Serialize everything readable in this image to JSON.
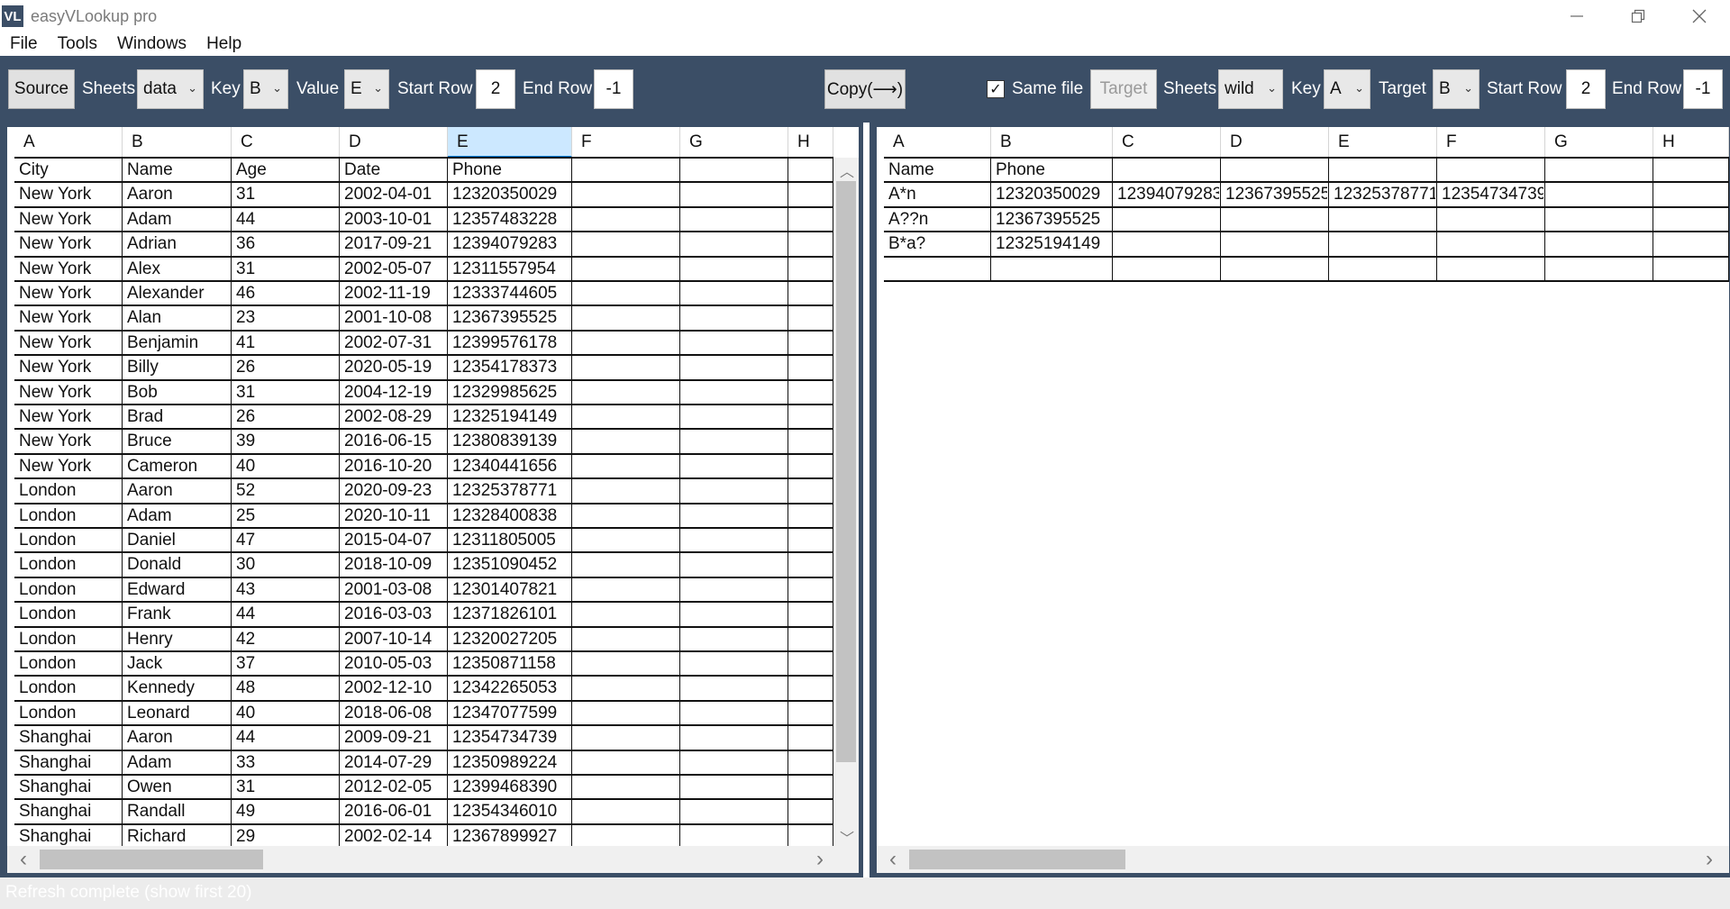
{
  "window": {
    "logo": "VL",
    "title": "easyVLookup pro",
    "controls": [
      "minimize-icon",
      "restore-icon",
      "close-icon"
    ]
  },
  "menu": [
    "File",
    "Tools",
    "Windows",
    "Help"
  ],
  "toolbar": {
    "source_label": "Source",
    "sheets_label": "Sheets",
    "source_sheet": "data",
    "key_label": "Key",
    "source_key": "B",
    "value_label": "Value",
    "source_value": "E",
    "start_row_label": "Start Row",
    "source_start_row": "2",
    "end_row_label": "End Row",
    "source_end_row": "-1",
    "copy_label": "Copy(⟶)",
    "same_file_label": "Same file",
    "same_file_checked": true,
    "target_button": "Target",
    "target_sheet": "wild",
    "target_key": "A",
    "target_label": "Target",
    "target_col": "B",
    "target_start_row": "2",
    "target_end_row": "-1"
  },
  "left_grid": {
    "columns": [
      "A",
      "B",
      "C",
      "D",
      "E",
      "F",
      "G",
      "H"
    ],
    "active_column": "E",
    "rows": [
      [
        "City",
        "Name",
        "Age",
        "Date",
        "Phone"
      ],
      [
        "New York",
        "Aaron",
        "31",
        "2002-04-01",
        "12320350029"
      ],
      [
        "New York",
        "Adam",
        "44",
        "2003-10-01",
        "12357483228"
      ],
      [
        "New York",
        "Adrian",
        "36",
        "2017-09-21",
        "12394079283"
      ],
      [
        "New York",
        "Alex",
        "31",
        "2002-05-07",
        "12311557954"
      ],
      [
        "New York",
        "Alexander",
        "46",
        "2002-11-19",
        "12333744605"
      ],
      [
        "New York",
        "Alan",
        "23",
        "2001-10-08",
        "12367395525"
      ],
      [
        "New York",
        "Benjamin",
        "41",
        "2002-07-31",
        "12399576178"
      ],
      [
        "New York",
        "Billy",
        "26",
        "2020-05-19",
        "12354178373"
      ],
      [
        "New York",
        "Bob",
        "31",
        "2004-12-19",
        "12329985625"
      ],
      [
        "New York",
        "Brad",
        "26",
        "2002-08-29",
        "12325194149"
      ],
      [
        "New York",
        "Bruce",
        "39",
        "2016-06-15",
        "12380839139"
      ],
      [
        "New York",
        "Cameron",
        "40",
        "2016-10-20",
        "12340441656"
      ],
      [
        "London",
        "Aaron",
        "52",
        "2020-09-23",
        "12325378771"
      ],
      [
        "London",
        "Adam",
        "25",
        "2020-10-11",
        "12328400838"
      ],
      [
        "London",
        "Daniel",
        "47",
        "2015-04-07",
        "12311805005"
      ],
      [
        "London",
        "Donald",
        "30",
        "2018-10-09",
        "12351090452"
      ],
      [
        "London",
        "Edward",
        "43",
        "2001-03-08",
        "12301407821"
      ],
      [
        "London",
        "Frank",
        "44",
        "2016-03-03",
        "12371826101"
      ],
      [
        "London",
        "Henry",
        "42",
        "2007-10-14",
        "12320027205"
      ],
      [
        "London",
        "Jack",
        "37",
        "2010-05-03",
        "12350871158"
      ],
      [
        "London",
        "Kennedy",
        "48",
        "2002-12-10",
        "12342265053"
      ],
      [
        "London",
        "Leonard",
        "40",
        "2018-06-08",
        "12347077599"
      ],
      [
        "Shanghai",
        "Aaron",
        "44",
        "2009-09-21",
        "12354734739"
      ],
      [
        "Shanghai",
        "Adam",
        "33",
        "2014-07-29",
        "12350989224"
      ],
      [
        "Shanghai",
        "Owen",
        "31",
        "2012-02-05",
        "12399468390"
      ],
      [
        "Shanghai",
        "Randall",
        "49",
        "2016-06-01",
        "12354346010"
      ],
      [
        "Shanghai",
        "Richard",
        "29",
        "2002-02-14",
        "12367899927"
      ]
    ]
  },
  "right_grid": {
    "columns": [
      "A",
      "B",
      "C",
      "D",
      "E",
      "F",
      "G",
      "H"
    ],
    "rows": [
      [
        "Name",
        "Phone",
        "",
        "",
        "",
        "",
        "",
        ""
      ],
      [
        "A*n",
        "12320350029",
        "12394079283",
        "12367395525",
        "12325378771",
        "12354734739",
        "",
        ""
      ],
      [
        "A??n",
        "12367395525",
        "",
        "",
        "",
        "",
        "",
        ""
      ],
      [
        "B*a?",
        "12325194149",
        "",
        "",
        "",
        "",
        "",
        ""
      ],
      [
        "",
        "",
        "",
        "",
        "",
        "",
        "",
        ""
      ]
    ]
  },
  "status": "Refresh complete (show first 20)",
  "colors": {
    "toolbar_bg": "#3b4e66",
    "active_col_bg": "#cce8ff",
    "status_bg": "#ececec"
  }
}
